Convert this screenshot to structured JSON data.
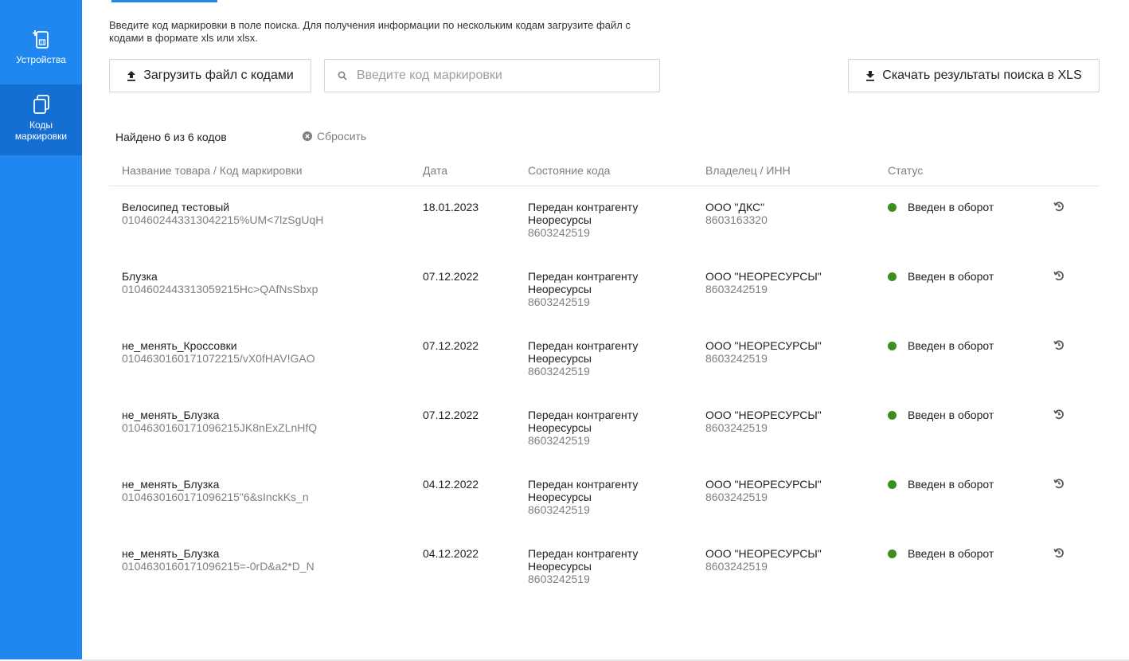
{
  "sidebar": {
    "items": [
      {
        "label": "Устройства",
        "icon": "device-plus-icon"
      },
      {
        "label": "Коды маркировки",
        "icon": "codes-copy-icon"
      }
    ]
  },
  "intro": {
    "text": "Введите код маркировки в поле поиска. Для получения информации по нескольким кодам загрузите файл с кодами в формате xls или xlsx."
  },
  "toolbar": {
    "upload_label": "Загрузить файл с кодами",
    "search_placeholder": "Введите код маркировки",
    "search_value": "",
    "download_label": "Скачать результаты поиска в XLS"
  },
  "results": {
    "found_text": "Найдено 6 из 6 кодов",
    "reset_label": "Сбросить"
  },
  "table": {
    "columns": [
      "Название товара / Код маркировки",
      "Дата",
      "Состояние кода",
      "Владелец / ИНН",
      "Статус"
    ],
    "rows": [
      {
        "name": "Велосипед тестовый",
        "code": "0104602443313042215%UM<7lzSgUqH",
        "date": "18.01.2023",
        "state": "Передан контрагенту",
        "state_org": "Неоресурсы",
        "state_inn": "8603242519",
        "owner": "ООО \"ДКС\"",
        "owner_inn": "8603163320",
        "status": "Введен в оборот"
      },
      {
        "name": "Блузка",
        "code": "0104602443313059215Hc>QAfNsSbxp",
        "date": "07.12.2022",
        "state": "Передан контрагенту",
        "state_org": "Неоресурсы",
        "state_inn": "8603242519",
        "owner": "ООО \"НЕОРЕСУРСЫ\"",
        "owner_inn": "8603242519",
        "status": "Введен в оборот"
      },
      {
        "name": "не_менять_Кроссовки",
        "code": "0104630160171072215/vX0fHAV!GAO",
        "date": "07.12.2022",
        "state": "Передан контрагенту",
        "state_org": "Неоресурсы",
        "state_inn": "8603242519",
        "owner": "ООО \"НЕОРЕСУРСЫ\"",
        "owner_inn": "8603242519",
        "status": "Введен в оборот"
      },
      {
        "name": "не_менять_Блузка",
        "code": "0104630160171096215JK8nExZLnHfQ",
        "date": "07.12.2022",
        "state": "Передан контрагенту",
        "state_org": "Неоресурсы",
        "state_inn": "8603242519",
        "owner": "ООО \"НЕОРЕСУРСЫ\"",
        "owner_inn": "8603242519",
        "status": "Введен в оборот"
      },
      {
        "name": "не_менять_Блузка",
        "code": "0104630160171096215\"6&sInckKs_n",
        "date": "04.12.2022",
        "state": "Передан контрагенту",
        "state_org": "Неоресурсы",
        "state_inn": "8603242519",
        "owner": "ООО \"НЕОРЕСУРСЫ\"",
        "owner_inn": "8603242519",
        "status": "Введен в оборот"
      },
      {
        "name": "не_менять_Блузка",
        "code": "0104630160171096215=-0rD&a2*D_N",
        "date": "04.12.2022",
        "state": "Передан контрагенту",
        "state_org": "Неоресурсы",
        "state_inn": "8603242519",
        "owner": "ООО \"НЕОРЕСУРСЫ\"",
        "owner_inn": "8603242519",
        "status": "Введен в оборот"
      }
    ]
  },
  "colors": {
    "sidebar": "#1f87ef",
    "sidebar_active": "#156fd2",
    "status_ok": "#3b8f1f"
  }
}
